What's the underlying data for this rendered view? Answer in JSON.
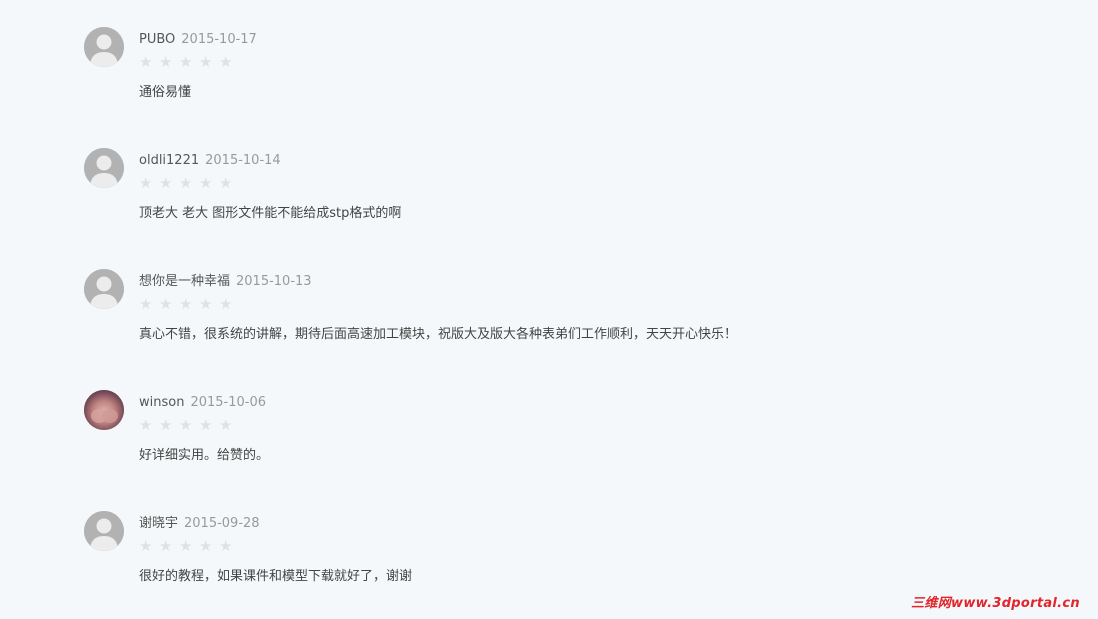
{
  "reviews": [
    {
      "username": "PUBO",
      "date": "2015-10-17",
      "rating": 0,
      "max_rating": 5,
      "content": "通俗易懂",
      "avatar": "default-user-icon"
    },
    {
      "username": "oldli1221",
      "date": "2015-10-14",
      "rating": 0,
      "max_rating": 5,
      "content": "顶老大 老大 图形文件能不能给成stp格式的啊",
      "avatar": "default-user-icon"
    },
    {
      "username": "想你是一种幸福",
      "date": "2015-10-13",
      "rating": 0,
      "max_rating": 5,
      "content": "真心不错，很系统的讲解，期待后面高速加工模块，祝版大及版大各种表弟们工作顺利，天天开心快乐！",
      "avatar": "default-user-icon"
    },
    {
      "username": "winson",
      "date": "2015-10-06",
      "rating": 0,
      "max_rating": 5,
      "content": "好详细实用。给赞的。",
      "avatar": "user-photo"
    },
    {
      "username": "谢晓宇",
      "date": "2015-09-28",
      "rating": 0,
      "max_rating": 5,
      "content": "很好的教程，如果课件和模型下载就好了，谢谢",
      "avatar": "default-user-icon"
    }
  ],
  "watermark": "三维网www.3dportal.cn",
  "colors": {
    "background": "#f5f8fa",
    "star_empty": "#e1e1e1",
    "avatar_default": "#b2b2b2",
    "watermark": "#e0252b"
  }
}
